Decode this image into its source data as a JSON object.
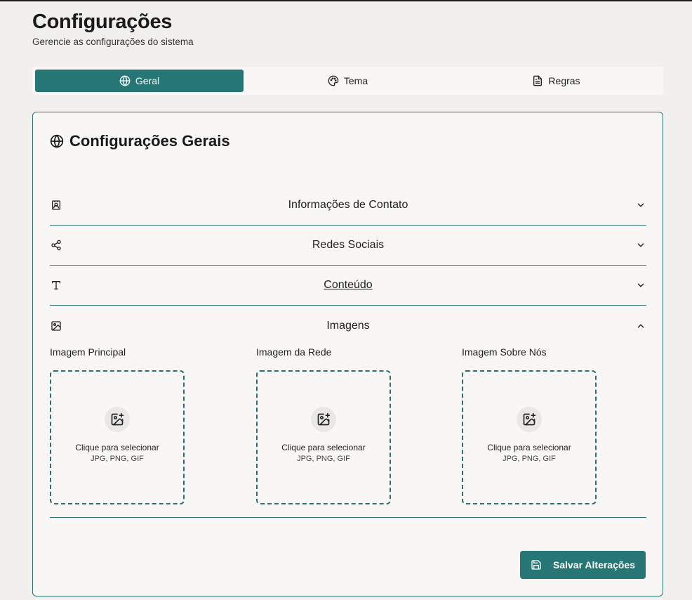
{
  "header": {
    "title": "Configurações",
    "subtitle": "Gerencie as configurações do sistema"
  },
  "tabs": [
    {
      "label": "Geral",
      "icon": "globe-icon",
      "active": true
    },
    {
      "label": "Tema",
      "icon": "palette-icon",
      "active": false
    },
    {
      "label": "Regras",
      "icon": "document-icon",
      "active": false
    }
  ],
  "card": {
    "title": "Configurações Gerais",
    "sections": [
      {
        "label": "Informações de Contato",
        "icon": "contact-card-icon",
        "expanded": false
      },
      {
        "label": "Redes Sociais",
        "icon": "share-icon",
        "expanded": false
      },
      {
        "label": "Conteúdo",
        "icon": "text-icon",
        "expanded": false
      },
      {
        "label": "Imagens",
        "icon": "image-icon",
        "expanded": true
      }
    ],
    "uploaders": [
      {
        "label": "Imagem Principal",
        "title": "Clique para selecionar",
        "hint": "JPG, PNG, GIF"
      },
      {
        "label": "Imagem da Rede",
        "title": "Clique para selecionar",
        "hint": "JPG, PNG, GIF"
      },
      {
        "label": "Imagem Sobre Nós",
        "title": "Clique para selecionar",
        "hint": "JPG, PNG, GIF"
      }
    ],
    "save_label": "Salvar Alterações"
  },
  "colors": {
    "accent": "#257675",
    "border": "#2b7473",
    "background": "#f1f0ee",
    "card_background": "#f8f7f5"
  }
}
